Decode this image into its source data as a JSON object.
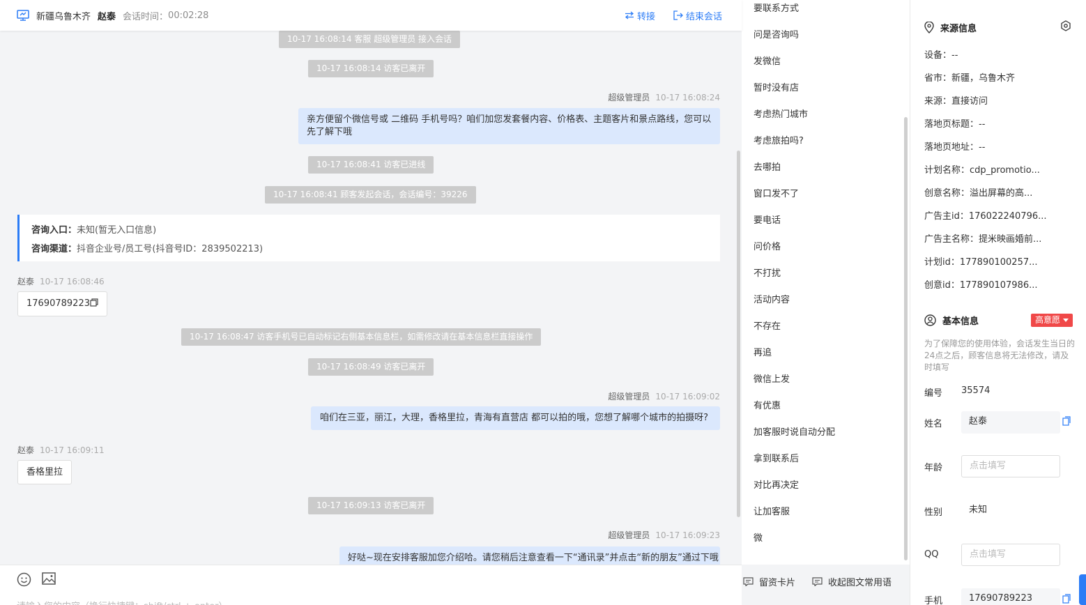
{
  "header": {
    "location": "新疆乌鲁木齐",
    "visitor_name": "赵泰",
    "time_label": "会话时间：",
    "time_value": "00:02:28",
    "transfer_label": "转接",
    "end_label": "结束会话"
  },
  "messages": {
    "sys1": "10-17 16:08:14 客服 超级管理员 接入会话",
    "sys2": "10-17 16:08:14 访客已离开",
    "agent1_name": "超级管理员",
    "agent1_time": "10-17 16:08:24",
    "agent1_text": "亲方便留个微信号或 二维码 手机号吗？咱们加您发套餐内容、价格表、主题客片和景点路线，您可以先了解下哦",
    "sys3": "10-17 16:08:41 访客已进线",
    "sys4": "10-17 16:08:41 顾客发起会话，会话编号：39226",
    "info_entry_label": "咨询入口：",
    "info_entry_value": "未知(暂无入口信息)",
    "info_channel_label": "咨询渠道：",
    "info_channel_value": "抖音企业号/员工号(抖音号ID：2839502213)",
    "visitor1_name": "赵泰",
    "visitor1_time": "10-17 16:08:46",
    "visitor1_text": "17690789223",
    "sys5": "10-17 16:08:47 访客手机号已自动标记右侧基本信息栏，如需修改请在基本信息栏直接操作",
    "sys6": "10-17 16:08:49 访客已离开",
    "agent2_name": "超级管理员",
    "agent2_time": "10-17 16:09:02",
    "agent2_text": "咱们在三亚，丽江，大理，香格里拉，青海有直营店 都可以拍的哦，您想了解哪个城市的拍摄呀?",
    "visitor2_name": "赵泰",
    "visitor2_time": "10-17 16:09:11",
    "visitor2_text": "香格里拉",
    "sys7": "10-17 16:09:13 访客已离开",
    "agent3_name": "超级管理员",
    "agent3_time": "10-17 16:09:23",
    "agent3_text": "好哒~现在安排客服加您介绍哈。请您稍后注意查看一下“通讯录”并点击“新的朋友”通过下哦"
  },
  "input": {
    "placeholder": "请输入您的内容（换行快捷键：shift/ctrl + enter）",
    "card_label": "留资卡片",
    "collapse_label": "收起图文常用语"
  },
  "phrases": [
    "要联系方式",
    "问是咨询吗",
    "发微信",
    "暂时没有店",
    "考虑热门城市",
    "考虑旅拍吗?",
    "去哪拍",
    "窗口发不了",
    "要电话",
    "问价格",
    "不打扰",
    "活动内容",
    "不存在",
    "再追",
    "微信上发",
    "有优惠",
    "加客服时说自动分配",
    "拿到联系后",
    "对比再决定",
    "让加客服",
    "微"
  ],
  "source": {
    "title": "来源信息",
    "rows": [
      "设备：--",
      "省市：新疆，乌鲁木齐",
      "来源：直接访问",
      "落地页标题：--",
      "落地页地址：--",
      "计划名称：cdp_promotio...",
      "创意名称：溢出屏幕的高...",
      "广告主id：176022240796...",
      "广告主名称：提米映画婚前...",
      "计划id：177890100257...",
      "创意id：177890107986..."
    ]
  },
  "basic": {
    "title": "基本信息",
    "intent": "高意愿",
    "hint": "为了保障您的使用体验，会话发生当日的24点之后，顾客信息将无法修改，请及时填写",
    "id_label": "编号",
    "id_value": "35574",
    "name_label": "姓名",
    "name_value": "赵泰",
    "age_label": "年龄",
    "age_placeholder": "点击填写",
    "gender_label": "性别",
    "gender_value": "未知",
    "qq_label": "QQ",
    "qq_placeholder": "点击填写",
    "phone_label": "手机",
    "phone_value": "17690789223"
  },
  "colors": {
    "accent": "#2b7cf6",
    "agent_bubble": "#dbe8fd",
    "system_pill": "#cbcbcb",
    "intent_badge": "#f04848"
  }
}
